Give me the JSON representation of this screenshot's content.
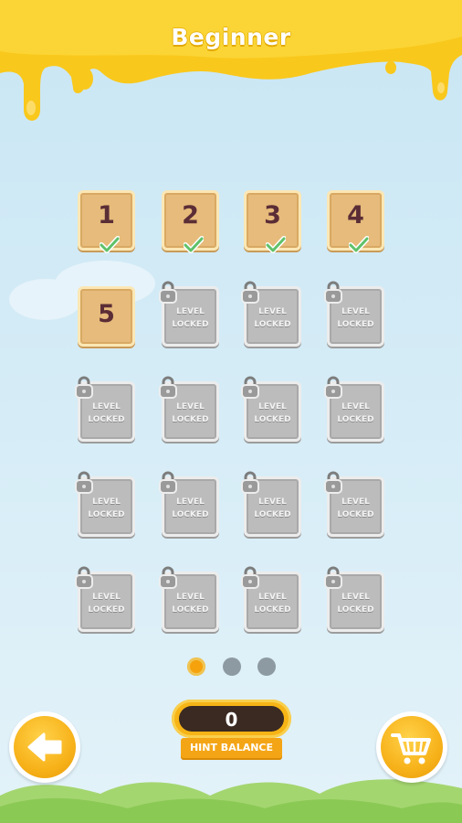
{
  "header": {
    "title": "Beginner"
  },
  "levels": [
    {
      "label": "1",
      "state": "completed"
    },
    {
      "label": "2",
      "state": "completed"
    },
    {
      "label": "3",
      "state": "completed"
    },
    {
      "label": "4",
      "state": "completed"
    },
    {
      "label": "5",
      "state": "unlocked"
    },
    {
      "line1": "LEVEL",
      "line2": "LOCKED",
      "state": "locked"
    },
    {
      "line1": "LEVEL",
      "line2": "LOCKED",
      "state": "locked"
    },
    {
      "line1": "LEVEL",
      "line2": "LOCKED",
      "state": "locked"
    },
    {
      "line1": "LEVEL",
      "line2": "LOCKED",
      "state": "locked"
    },
    {
      "line1": "LEVEL",
      "line2": "LOCKED",
      "state": "locked"
    },
    {
      "line1": "LEVEL",
      "line2": "LOCKED",
      "state": "locked"
    },
    {
      "line1": "LEVEL",
      "line2": "LOCKED",
      "state": "locked"
    },
    {
      "line1": "LEVEL",
      "line2": "LOCKED",
      "state": "locked"
    },
    {
      "line1": "LEVEL",
      "line2": "LOCKED",
      "state": "locked"
    },
    {
      "line1": "LEVEL",
      "line2": "LOCKED",
      "state": "locked"
    },
    {
      "line1": "LEVEL",
      "line2": "LOCKED",
      "state": "locked"
    },
    {
      "line1": "LEVEL",
      "line2": "LOCKED",
      "state": "locked"
    },
    {
      "line1": "LEVEL",
      "line2": "LOCKED",
      "state": "locked"
    },
    {
      "line1": "LEVEL",
      "line2": "LOCKED",
      "state": "locked"
    },
    {
      "line1": "LEVEL",
      "line2": "LOCKED",
      "state": "locked"
    }
  ],
  "pager": {
    "pages": 3,
    "active_page": 1
  },
  "hint": {
    "value": "0",
    "label": "HINT BALANCE"
  },
  "buttons": {
    "back_icon": "arrow-left-icon",
    "shop_icon": "cart-icon"
  },
  "colors": {
    "honey": "#f9c81c",
    "tile_open": "#e6bb7b",
    "tile_locked": "#bcbcbc",
    "number_text": "#5b2d36",
    "check": "#5fc16a",
    "dot_active": "#f5a20d",
    "dot_inactive": "#8e9aa1"
  }
}
